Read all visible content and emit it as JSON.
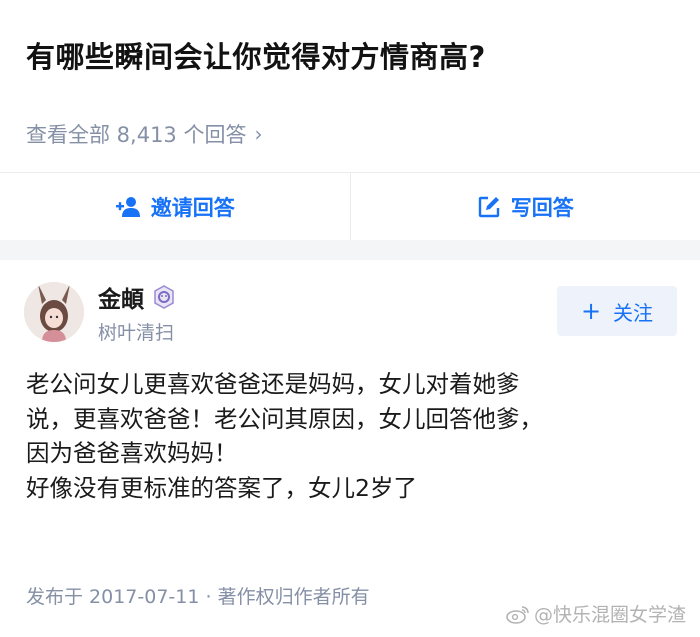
{
  "question": {
    "title": "有哪些瞬间会让你觉得对方情商高?",
    "view_all": "查看全部 8,413 个回答"
  },
  "actions": {
    "invite_label": "邀请回答",
    "write_label": "写回答"
  },
  "answer": {
    "author_name": "金頔",
    "author_bio": "树叶清扫",
    "follow_label": "关注",
    "content_lines": [
      "老公问女儿更喜欢爸爸还是妈妈，女儿对着她爹",
      "说，更喜欢爸爸！老公问其原因，女儿回答他爹，",
      "因为爸爸喜欢妈妈！",
      "好像没有更标准的答案了，女儿2岁了"
    ],
    "footer": "发布于 2017-07-11 · 著作权归作者所有"
  },
  "watermark": "@快乐混圈女学渣",
  "colors": {
    "accent": "#1772f6",
    "meta_gray": "#8590a6",
    "divider_bg": "#f4f5f7"
  }
}
